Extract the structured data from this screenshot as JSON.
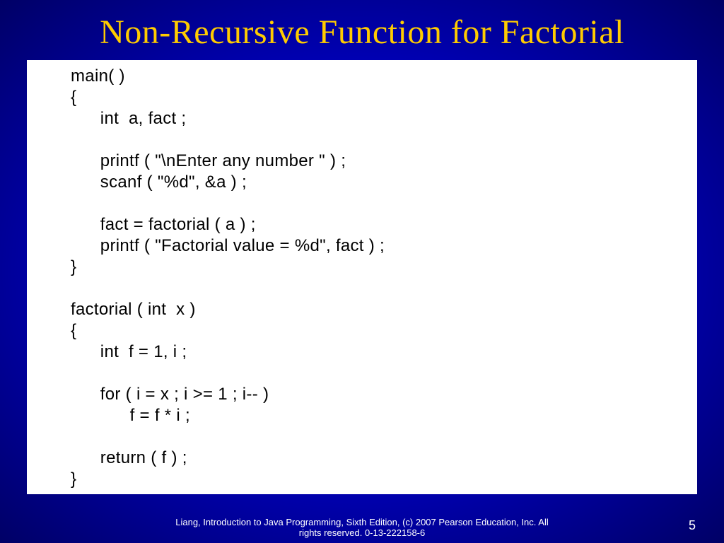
{
  "title": "Non-Recursive Function for Factorial",
  "code": "main( )\n{\n      int  a, fact ;\n\n      printf ( \"\\nEnter any number \" ) ;\n      scanf ( \"%d\", &a ) ;\n\n      fact = factorial ( a ) ;\n      printf ( \"Factorial value = %d\", fact ) ;\n}\n\nfactorial ( int  x )\n{\n      int  f = 1, i ;\n\n      for ( i = x ; i >= 1 ; i-- )\n            f = f * i ;\n\n      return ( f ) ;\n}",
  "footer_line1": "Liang, Introduction to Java Programming, Sixth Edition, (c) 2007 Pearson Education, Inc. All",
  "footer_line2": "rights reserved. 0-13-222158-6",
  "page_number": "5"
}
